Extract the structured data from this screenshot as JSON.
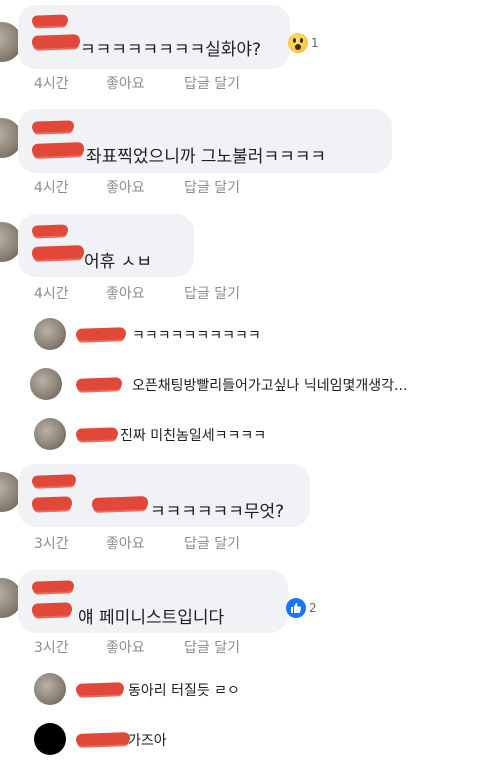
{
  "comments": [
    {
      "text": "ㅋㅋㅋㅋㅋㅋㅋㅋ실화야?",
      "time": "4시간",
      "like": "좋아요",
      "reply": "답글 달기",
      "reaction_icon": "wow-icon",
      "reaction_count": "1"
    },
    {
      "text": "좌표찍었으니까 그노불러ㅋㅋㅋㅋ",
      "time": "4시간",
      "like": "좋아요",
      "reply": "답글 달기"
    },
    {
      "text": "어휴 ㅅㅂ",
      "time": "4시간",
      "like": "좋아요",
      "reply": "답글 달기",
      "replies": [
        {
          "text": "ㅋㅋㅋㅋㅋㅋㅋㅋㅋㅋ"
        },
        {
          "text": "오픈채팅방빨리들어가고싶나 닉네임몇개생각..."
        },
        {
          "text": "진짜 미친놈일세ㅋㅋㅋㅋ"
        }
      ]
    },
    {
      "text": "ㅋㅋㅋㅋㅋㅋ무엇?",
      "time": "3시간",
      "like": "좋아요",
      "reply": "답글 달기"
    },
    {
      "text": "얘 페미니스트입니다",
      "time": "3시간",
      "like": "좋아요",
      "reply": "답글 달기",
      "reaction_icon": "like-icon",
      "reaction_count": "2",
      "replies": [
        {
          "text": "동아리 터질듯 ㄹㅇ"
        },
        {
          "text": "가즈아"
        }
      ]
    }
  ],
  "colors": {
    "bubble": "#f0f2f5",
    "meta": "#8a8d91",
    "redaction": "#e0483a",
    "like_blue": "#1877f2"
  }
}
